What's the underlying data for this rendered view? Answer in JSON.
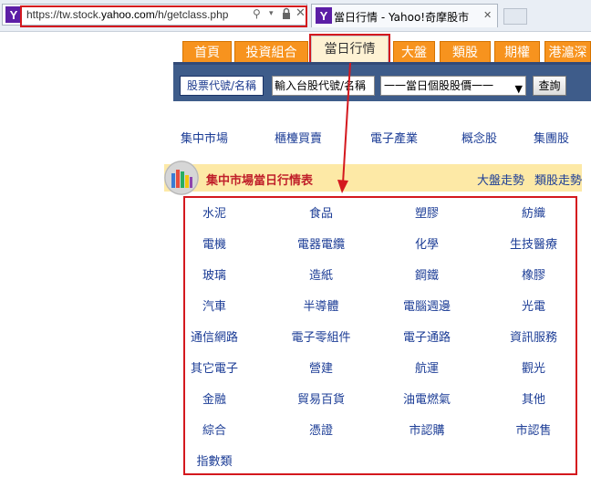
{
  "browser": {
    "url_prefix": "https://tw.stock.",
    "url_domain": "yahoo.com",
    "url_path": "/h/getclass.php",
    "tab_title": "當日行情 - Yahoo!奇摩股市",
    "tab_close": "✕",
    "logo_letter": "Y"
  },
  "nav": {
    "tabs": [
      "首頁",
      "投資組合",
      "當日行情",
      "大盤",
      "類股",
      "期權",
      "港滬深"
    ],
    "active_index": 2
  },
  "search": {
    "label": "股票代號/名稱",
    "input_value": "輸入台股代號/名稱",
    "select_value": "一一當日個股股價一一",
    "button": "查詢"
  },
  "markets": [
    "集中市場",
    "櫃檯買賣",
    "電子產業",
    "概念股",
    "集團股"
  ],
  "section": {
    "title": "集中市場當日行情表",
    "links": [
      "大盤走勢",
      "類股走勢"
    ]
  },
  "categories": [
    [
      "水泥",
      "食品",
      "塑膠",
      "紡織"
    ],
    [
      "電機",
      "電器電纜",
      "化學",
      "生技醫療"
    ],
    [
      "玻璃",
      "造紙",
      "鋼鐵",
      "橡膠"
    ],
    [
      "汽車",
      "半導體",
      "電腦週邊",
      "光電"
    ],
    [
      "通信網路",
      "電子零組件",
      "電子通路",
      "資訊服務"
    ],
    [
      "其它電子",
      "營建",
      "航運",
      "觀光"
    ],
    [
      "金融",
      "貿易百貨",
      "油電燃氣",
      "其他"
    ],
    [
      "綜合",
      "憑證",
      "市認購",
      "市認售"
    ],
    [
      "指數類"
    ]
  ],
  "colors": {
    "nav_tab": "#f7931e",
    "link": "#1c3d96",
    "section_bg": "#fde9a6",
    "section_title": "#c0202a",
    "annotation_red": "#d4181e"
  }
}
